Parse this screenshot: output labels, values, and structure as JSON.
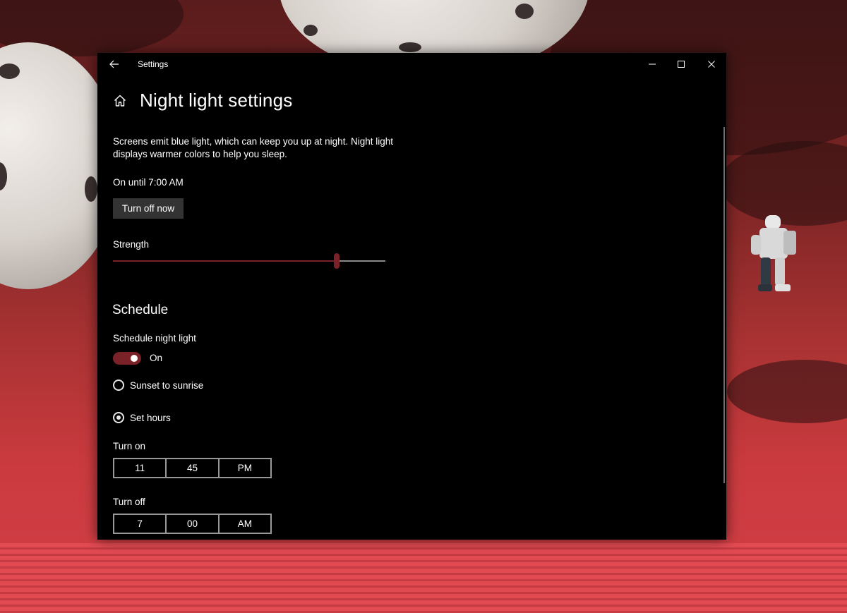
{
  "window": {
    "title": "Settings"
  },
  "page": {
    "title": "Night light settings",
    "description": "Screens emit blue light, which can keep you up at night. Night light displays warmer colors to help you sleep.",
    "status": "On until 7:00 AM",
    "turn_off_now_label": "Turn off now"
  },
  "strength": {
    "label": "Strength",
    "value_percent": 82
  },
  "schedule": {
    "heading": "Schedule",
    "label": "Schedule night light",
    "toggle_on": true,
    "toggle_state": "On",
    "options": [
      {
        "label": "Sunset to sunrise",
        "selected": false
      },
      {
        "label": "Set hours",
        "selected": true
      }
    ],
    "turn_on": {
      "label": "Turn on",
      "hour": "11",
      "minute": "45",
      "period": "PM"
    },
    "turn_off": {
      "label": "Turn off",
      "hour": "7",
      "minute": "00",
      "period": "AM"
    }
  },
  "colors": {
    "accent": "#7a2228",
    "window_bg": "#000000",
    "button_bg": "#333333",
    "text": "#ffffff"
  },
  "icons": {
    "back": "back-arrow-icon",
    "home": "home-icon",
    "minimize": "minimize-icon",
    "maximize": "maximize-icon",
    "close": "close-icon"
  }
}
